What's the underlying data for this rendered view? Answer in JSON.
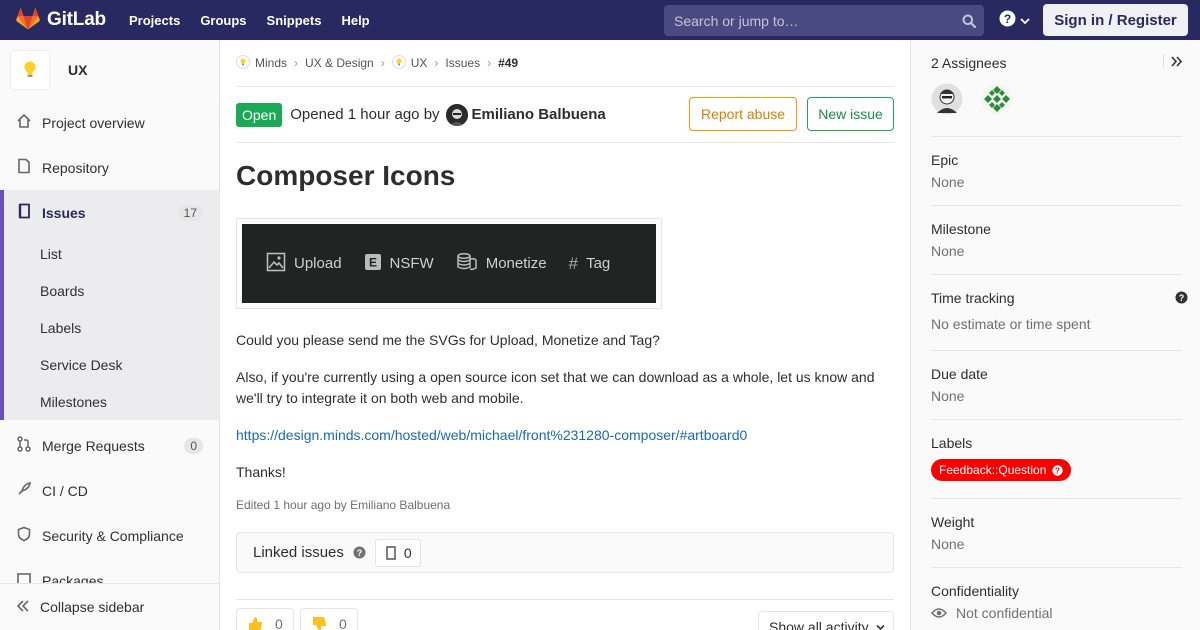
{
  "navbar": {
    "brand": "GitLab",
    "links": [
      "Projects",
      "Groups",
      "Snippets",
      "Help"
    ],
    "search_placeholder": "Search or jump to…",
    "signin": "Sign in / Register",
    "colors": {
      "bg": "#292961",
      "brand_orange": "#fc6d26"
    }
  },
  "sidebar": {
    "project_name": "UX",
    "items": {
      "overview": "Project overview",
      "repository": "Repository",
      "issues": "Issues",
      "issues_count": "17",
      "merge_requests": "Merge Requests",
      "mr_count": "0",
      "cicd": "CI / CD",
      "security": "Security & Compliance",
      "packages": "Packages"
    },
    "issue_sub": [
      "List",
      "Boards",
      "Labels",
      "Service Desk",
      "Milestones"
    ],
    "collapse": "Collapse sidebar"
  },
  "breadcrumbs": [
    "Minds",
    "UX & Design",
    "UX",
    "Issues",
    "#49"
  ],
  "issue": {
    "status": "Open",
    "opened_text": "Opened 1 hour ago by",
    "author": "Emiliano Balbuena",
    "report_abuse": "Report abuse",
    "new_issue": "New issue",
    "title": "Composer Icons",
    "image_items": [
      "Upload",
      "NSFW",
      "Monetize",
      "Tag"
    ],
    "p1": "Could you please send me the SVGs for Upload, Monetize and Tag?",
    "p2": "Also, if you're currently using a open source icon set that we can download as a whole, let us know and we'll try to integrate it on both web and mobile.",
    "link": "https://design.minds.com/hosted/web/michael/front%231280-composer/#artboard0",
    "p3": "Thanks!",
    "edited": "Edited 1 hour ago by Emiliano Balbuena",
    "linked_title": "Linked issues",
    "linked_count": "0",
    "thumbs_up": "0",
    "thumbs_down": "0",
    "activity": "Show all activity"
  },
  "rsidebar": {
    "assignees": "2 Assignees",
    "epic_title": "Epic",
    "epic_value": "None",
    "milestone_title": "Milestone",
    "milestone_value": "None",
    "time_title": "Time tracking",
    "time_value": "No estimate or time spent",
    "due_title": "Due date",
    "due_value": "None",
    "labels_title": "Labels",
    "label_value": "Feedback::Question",
    "weight_title": "Weight",
    "weight_value": "None",
    "conf_title": "Confidentiality",
    "conf_value": "Not confidential"
  }
}
